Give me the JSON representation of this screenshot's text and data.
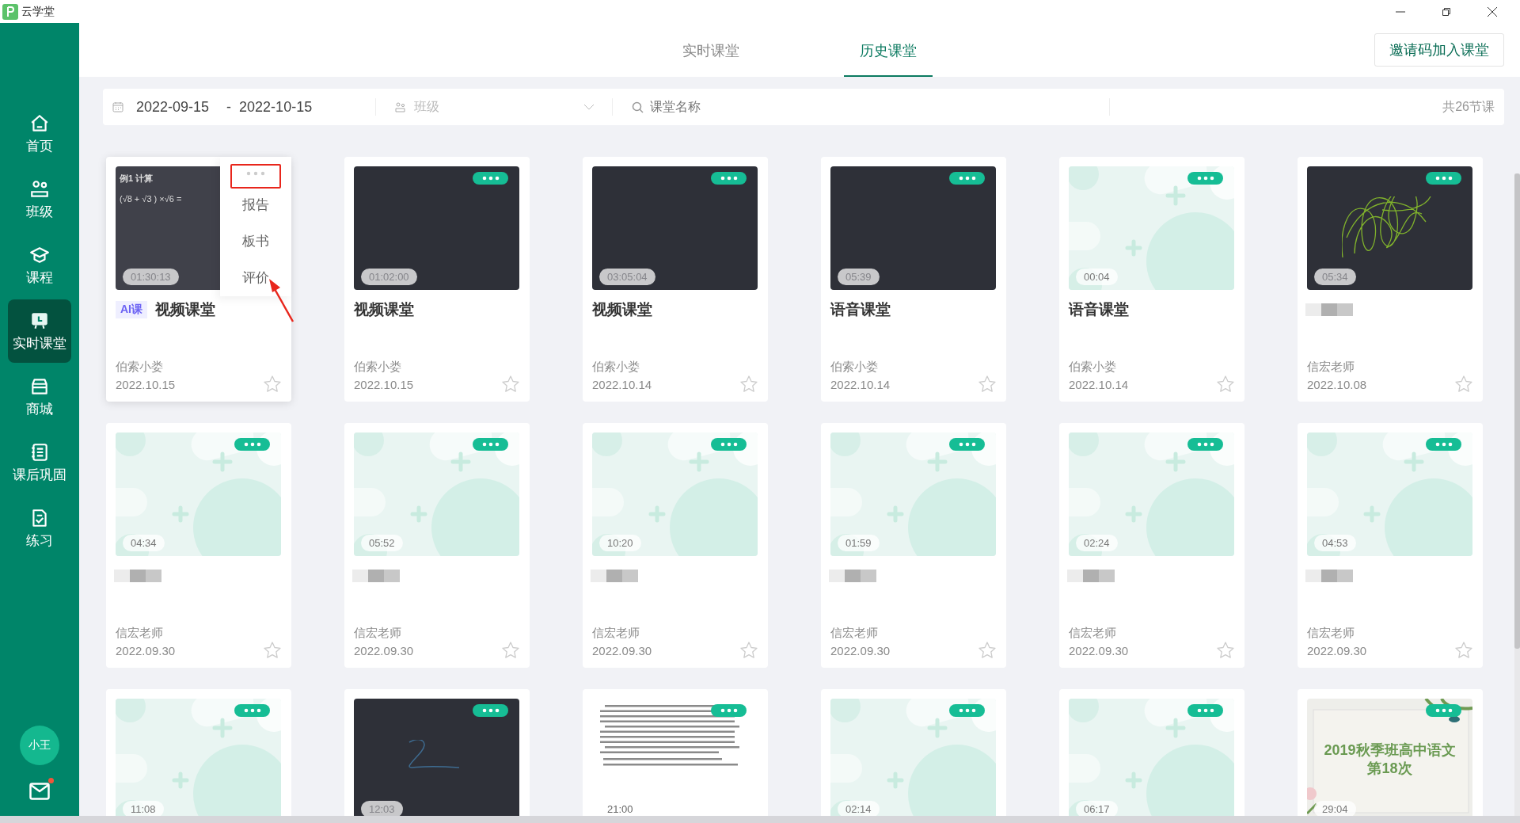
{
  "window": {
    "app_name": "云学堂"
  },
  "sidebar": {
    "items": [
      {
        "label": "首页",
        "selected": false
      },
      {
        "label": "班级",
        "selected": false
      },
      {
        "label": "课程",
        "selected": false
      },
      {
        "label": "实时课堂",
        "selected": true
      },
      {
        "label": "商城",
        "selected": false
      },
      {
        "label": "课后巩固",
        "selected": false
      },
      {
        "label": "练习",
        "selected": false
      }
    ],
    "avatar": "小王",
    "mail_unread": true
  },
  "tabs": [
    {
      "label": "实时课堂",
      "selected": false
    },
    {
      "label": "历史课堂",
      "selected": true
    }
  ],
  "invite_button": "邀请码加入课堂",
  "filters": {
    "start_date": "2022-09-15",
    "separator": "-",
    "end_date": "2022-10-15",
    "class_placeholder": "班级",
    "search_placeholder": "课堂名称",
    "total": "共26节课"
  },
  "card_menu": [
    "报告",
    "板书",
    "评价"
  ],
  "cards": [
    {
      "cover_lines": [
        "例1  计算",
        "(√8 + √3 ) ×√6 ="
      ],
      "duration": "01:30:13",
      "tag": "AI课",
      "title": "视频课堂",
      "teacher": "伯索小娄",
      "date": "2022.10.15",
      "starred": false,
      "menu_open": true
    },
    {
      "duration": "01:02:00",
      "title": "视频课堂",
      "teacher": "伯索小娄",
      "date": "2022.10.15",
      "starred": false,
      "menu_open": false
    },
    {
      "duration": "03:05:04",
      "title": "视频课堂",
      "teacher": "伯索小娄",
      "date": "2022.10.14",
      "starred": false,
      "menu_open": false
    },
    {
      "duration": "05:39",
      "title": "语音课堂",
      "teacher": "伯索小娄",
      "date": "2022.10.14",
      "starred": false,
      "menu_open": false
    },
    {
      "duration": "00:04",
      "title": "语音课堂",
      "teacher": "伯索小娄",
      "date": "2022.10.14",
      "starred": false,
      "menu_open": false
    },
    {
      "duration": "05:34",
      "title_redacted": true,
      "teacher": "信宏老师",
      "date": "2022.10.08",
      "starred": false,
      "menu_open": false
    },
    {
      "duration": "04:34",
      "title_redacted": true,
      "teacher": "信宏老师",
      "date": "2022.09.30",
      "starred": false,
      "menu_open": false
    },
    {
      "duration": "05:52",
      "title_redacted": true,
      "teacher": "信宏老师",
      "date": "2022.09.30",
      "starred": false,
      "menu_open": false
    },
    {
      "duration": "10:20",
      "title_redacted": true,
      "teacher": "信宏老师",
      "date": "2022.09.30",
      "starred": false,
      "menu_open": false
    },
    {
      "duration": "01:59",
      "title_redacted": true,
      "teacher": "信宏老师",
      "date": "2022.09.30",
      "starred": false,
      "menu_open": false
    },
    {
      "duration": "02:24",
      "title_redacted": true,
      "teacher": "信宏老师",
      "date": "2022.09.30",
      "starred": false,
      "menu_open": false
    },
    {
      "duration": "04:53",
      "title_redacted": true,
      "teacher": "信宏老师",
      "date": "2022.09.30",
      "starred": false,
      "menu_open": false
    },
    {
      "duration": "11:08",
      "menu_open": false
    },
    {
      "duration": "12:03",
      "menu_open": false
    },
    {
      "duration": "21:00",
      "menu_open": false
    },
    {
      "duration": "02:14",
      "menu_open": false
    },
    {
      "duration": "06:17",
      "menu_open": false
    },
    {
      "cover_lines": [
        "2019秋季班高中语文",
        "第18次"
      ],
      "duration": "29:04",
      "menu_open": false
    }
  ]
}
